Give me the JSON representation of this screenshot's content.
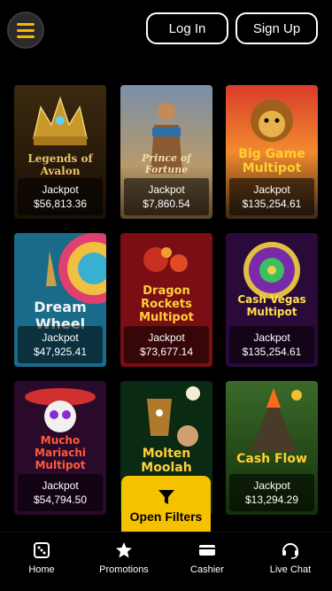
{
  "header": {
    "menu_icon": "hamburger-icon",
    "login_label": "Log In",
    "signup_label": "Sign Up"
  },
  "games": [
    {
      "title": "Legends of Avalon",
      "jackpot_label": "Jackpot",
      "jackpot_value": "$56,813.36"
    },
    {
      "title": "Prince of Fortune",
      "jackpot_label": "Jackpot",
      "jackpot_value": "$7,860.54"
    },
    {
      "title": "Big Game Multipot",
      "jackpot_label": "Jackpot",
      "jackpot_value": "$135,254.61"
    },
    {
      "title": "Dream Wheel",
      "jackpot_label": "Jackpot",
      "jackpot_value": "$47,925.41"
    },
    {
      "title": "Dragon Rockets Multipot",
      "jackpot_label": "Jackpot",
      "jackpot_value": "$73,677.14"
    },
    {
      "title": "Cash Vegas Multipot",
      "jackpot_label": "Jackpot",
      "jackpot_value": "$135,254.61"
    },
    {
      "title": "Mucho Mariachi Multipot",
      "jackpot_label": "Jackpot",
      "jackpot_value": "$54,794.50"
    },
    {
      "title": "Molten Moolah",
      "jackpot_label": "",
      "jackpot_value": ""
    },
    {
      "title": "Cash Flow",
      "jackpot_label": "Jackpot",
      "jackpot_value": "$13,294.29"
    }
  ],
  "filters": {
    "label": "Open Filters",
    "icon": "funnel-icon"
  },
  "nav": [
    {
      "label": "Home",
      "icon": "dice-icon"
    },
    {
      "label": "Promotions",
      "icon": "star-icon"
    },
    {
      "label": "Cashier",
      "icon": "credit-card-icon"
    },
    {
      "label": "Live Chat",
      "icon": "headset-icon"
    }
  ],
  "colors": {
    "accent": "#f5c200",
    "background": "#000000"
  }
}
